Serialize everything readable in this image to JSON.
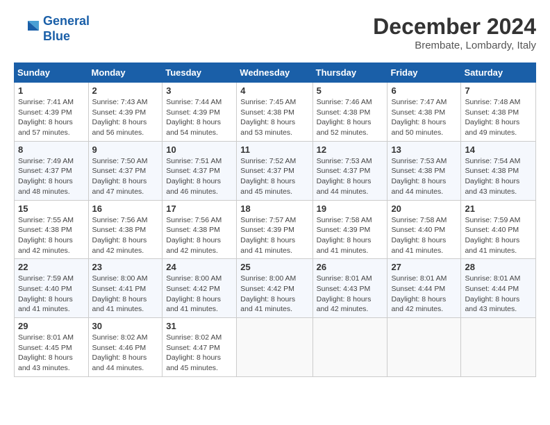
{
  "logo": {
    "line1": "General",
    "line2": "Blue"
  },
  "title": "December 2024",
  "subtitle": "Brembate, Lombardy, Italy",
  "weekdays": [
    "Sunday",
    "Monday",
    "Tuesday",
    "Wednesday",
    "Thursday",
    "Friday",
    "Saturday"
  ],
  "weeks": [
    [
      {
        "day": "1",
        "sunrise": "7:41 AM",
        "sunset": "4:39 PM",
        "daylight": "8 hours and 57 minutes."
      },
      {
        "day": "2",
        "sunrise": "7:43 AM",
        "sunset": "4:39 PM",
        "daylight": "8 hours and 56 minutes."
      },
      {
        "day": "3",
        "sunrise": "7:44 AM",
        "sunset": "4:39 PM",
        "daylight": "8 hours and 54 minutes."
      },
      {
        "day": "4",
        "sunrise": "7:45 AM",
        "sunset": "4:38 PM",
        "daylight": "8 hours and 53 minutes."
      },
      {
        "day": "5",
        "sunrise": "7:46 AM",
        "sunset": "4:38 PM",
        "daylight": "8 hours and 52 minutes."
      },
      {
        "day": "6",
        "sunrise": "7:47 AM",
        "sunset": "4:38 PM",
        "daylight": "8 hours and 50 minutes."
      },
      {
        "day": "7",
        "sunrise": "7:48 AM",
        "sunset": "4:38 PM",
        "daylight": "8 hours and 49 minutes."
      }
    ],
    [
      {
        "day": "8",
        "sunrise": "7:49 AM",
        "sunset": "4:37 PM",
        "daylight": "8 hours and 48 minutes."
      },
      {
        "day": "9",
        "sunrise": "7:50 AM",
        "sunset": "4:37 PM",
        "daylight": "8 hours and 47 minutes."
      },
      {
        "day": "10",
        "sunrise": "7:51 AM",
        "sunset": "4:37 PM",
        "daylight": "8 hours and 46 minutes."
      },
      {
        "day": "11",
        "sunrise": "7:52 AM",
        "sunset": "4:37 PM",
        "daylight": "8 hours and 45 minutes."
      },
      {
        "day": "12",
        "sunrise": "7:53 AM",
        "sunset": "4:37 PM",
        "daylight": "8 hours and 44 minutes."
      },
      {
        "day": "13",
        "sunrise": "7:53 AM",
        "sunset": "4:38 PM",
        "daylight": "8 hours and 44 minutes."
      },
      {
        "day": "14",
        "sunrise": "7:54 AM",
        "sunset": "4:38 PM",
        "daylight": "8 hours and 43 minutes."
      }
    ],
    [
      {
        "day": "15",
        "sunrise": "7:55 AM",
        "sunset": "4:38 PM",
        "daylight": "8 hours and 42 minutes."
      },
      {
        "day": "16",
        "sunrise": "7:56 AM",
        "sunset": "4:38 PM",
        "daylight": "8 hours and 42 minutes."
      },
      {
        "day": "17",
        "sunrise": "7:56 AM",
        "sunset": "4:38 PM",
        "daylight": "8 hours and 42 minutes."
      },
      {
        "day": "18",
        "sunrise": "7:57 AM",
        "sunset": "4:39 PM",
        "daylight": "8 hours and 41 minutes."
      },
      {
        "day": "19",
        "sunrise": "7:58 AM",
        "sunset": "4:39 PM",
        "daylight": "8 hours and 41 minutes."
      },
      {
        "day": "20",
        "sunrise": "7:58 AM",
        "sunset": "4:40 PM",
        "daylight": "8 hours and 41 minutes."
      },
      {
        "day": "21",
        "sunrise": "7:59 AM",
        "sunset": "4:40 PM",
        "daylight": "8 hours and 41 minutes."
      }
    ],
    [
      {
        "day": "22",
        "sunrise": "7:59 AM",
        "sunset": "4:40 PM",
        "daylight": "8 hours and 41 minutes."
      },
      {
        "day": "23",
        "sunrise": "8:00 AM",
        "sunset": "4:41 PM",
        "daylight": "8 hours and 41 minutes."
      },
      {
        "day": "24",
        "sunrise": "8:00 AM",
        "sunset": "4:42 PM",
        "daylight": "8 hours and 41 minutes."
      },
      {
        "day": "25",
        "sunrise": "8:00 AM",
        "sunset": "4:42 PM",
        "daylight": "8 hours and 41 minutes."
      },
      {
        "day": "26",
        "sunrise": "8:01 AM",
        "sunset": "4:43 PM",
        "daylight": "8 hours and 42 minutes."
      },
      {
        "day": "27",
        "sunrise": "8:01 AM",
        "sunset": "4:44 PM",
        "daylight": "8 hours and 42 minutes."
      },
      {
        "day": "28",
        "sunrise": "8:01 AM",
        "sunset": "4:44 PM",
        "daylight": "8 hours and 43 minutes."
      }
    ],
    [
      {
        "day": "29",
        "sunrise": "8:01 AM",
        "sunset": "4:45 PM",
        "daylight": "8 hours and 43 minutes."
      },
      {
        "day": "30",
        "sunrise": "8:02 AM",
        "sunset": "4:46 PM",
        "daylight": "8 hours and 44 minutes."
      },
      {
        "day": "31",
        "sunrise": "8:02 AM",
        "sunset": "4:47 PM",
        "daylight": "8 hours and 45 minutes."
      },
      null,
      null,
      null,
      null
    ]
  ]
}
